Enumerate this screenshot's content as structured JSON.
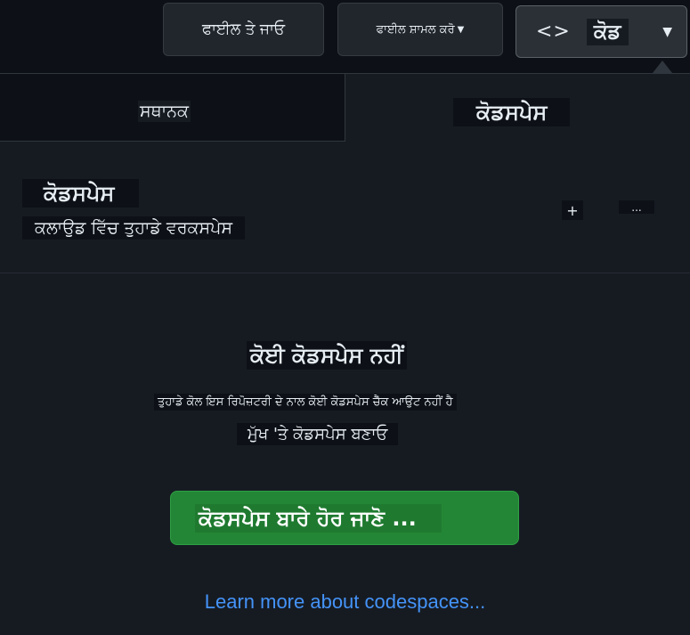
{
  "toolbar": {
    "goto_file": "ਫਾਈਲ ਤੇ ਜਾਓ",
    "add_file": "ਫਾਈਲ ਸ਼ਾਮਲ ਕਰੋ",
    "code_label": "ਕੋਡ",
    "code_icon": "<>"
  },
  "tabs": {
    "local": "ਸਥਾਨਕ",
    "codespaces": "ਕੋਡਸਪੇਸ"
  },
  "codespaces_header": {
    "title": "ਕੋਡਸਪੇਸ",
    "subtitle": "ਕਲਾਉਡ ਵਿੱਚ ਤੁਹਾਡੇ ਵਰਕਸਪੇਸ",
    "add_icon": "+",
    "more_icon": "..."
  },
  "empty_state": {
    "title": "ਕੋਈ ਕੋਡਸਪੇਸ ਨਹੀਂ",
    "description": "ਤੁਹਾਡੇ ਕੋਲ ਇਸ ਰਿਪੋਜ਼ਟਰੀ ਦੇ ਨਾਲ ਕੋਈ ਕੋਡਸਪੇਸ ਚੈੱਕ ਆਉਟ ਨਹੀਂ ਹੈ",
    "create_text": "ਮੁੱਖ 'ਤੇ ਕੋਡਸਪੇਸ ਬਣਾਓ",
    "learn_button": "ਕੋਡਸਪੇਸ ਬਾਰੇ ਹੋਰ ਜਾਣੋ ...",
    "learn_link": "Learn more about codespaces..."
  },
  "colors": {
    "background": "#0d1117",
    "panel": "#161b22",
    "primary_button": "#238636",
    "link": "#4493f8"
  }
}
